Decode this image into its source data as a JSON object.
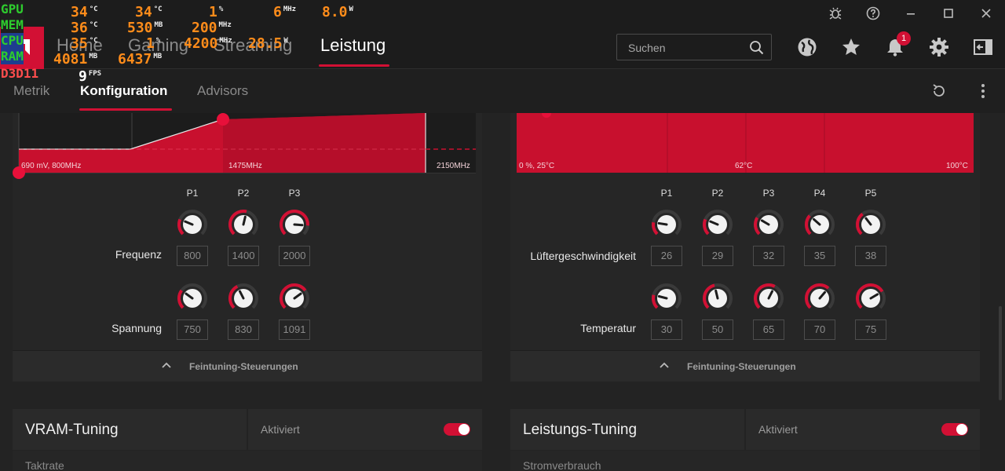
{
  "colors": {
    "accent": "#d21034",
    "osd_green": "#2ecc2e",
    "osd_orange": "#ff8c1a",
    "osd_red": "#ff4d4d"
  },
  "osd": {
    "rows": [
      {
        "label": "GPU",
        "values": [
          {
            "v": "34",
            "u": "°C"
          },
          {
            "v": "34",
            "u": "°C"
          },
          {
            "v": "1",
            "u": "%"
          },
          {
            "v": "6",
            "u": "MHz"
          },
          {
            "v": "8.0",
            "u": "W"
          }
        ]
      },
      {
        "label": "MEM",
        "values": [
          {
            "v": "36",
            "u": "°C"
          },
          {
            "v": "530",
            "u": "MB"
          },
          {
            "v": "200",
            "u": "MHz"
          }
        ]
      },
      {
        "label": "CPU",
        "values": [
          {
            "v": "35",
            "u": "°C"
          },
          {
            "v": "1",
            "u": "%"
          },
          {
            "v": "4200",
            "u": "MHz"
          },
          {
            "v": "28.5",
            "u": "W"
          }
        ]
      },
      {
        "label": "RAM",
        "values": [
          {
            "v": "4081",
            "u": "MB"
          },
          {
            "v": "6437",
            "u": "MB"
          }
        ]
      },
      {
        "label": "D3D11",
        "values": [
          {
            "v": "9",
            "u": "FPS"
          }
        ]
      }
    ]
  },
  "window": {
    "icons": [
      "bug-icon",
      "help-icon",
      "minimize-icon",
      "maximize-icon",
      "close-icon"
    ]
  },
  "nav": {
    "tabs": [
      {
        "label": "Home"
      },
      {
        "label": "Gaming"
      },
      {
        "label": "Streaming"
      },
      {
        "label": "Leistung"
      }
    ],
    "active": "Leistung",
    "search_placeholder": "Suchen",
    "notification_count": "1"
  },
  "subnav": {
    "tabs": [
      {
        "label": "Metrik"
      },
      {
        "label": "Konfiguration"
      },
      {
        "label": "Advisors"
      }
    ]
  },
  "gpu_tuning": {
    "chart": {
      "left_label": "690 mV, 800MHz",
      "mid_label": "1475MHz",
      "right_label": "2150MHz"
    },
    "states": [
      "P1",
      "P2",
      "P3"
    ],
    "rows": [
      {
        "label": "Frequenz",
        "values": [
          "800",
          "1400",
          "2000"
        ],
        "levels": [
          0.25,
          0.55,
          0.85
        ]
      },
      {
        "label": "Spannung",
        "values": [
          "750",
          "830",
          "1091"
        ],
        "levels": [
          0.3,
          0.4,
          0.7
        ]
      }
    ],
    "footer": "Feintuning-Steuerungen"
  },
  "fan_tuning": {
    "chart": {
      "left_label": "0 %, 25°C",
      "mid_label": "62°C",
      "right_label": "100°C"
    },
    "states": [
      "P1",
      "P2",
      "P3",
      "P4",
      "P5"
    ],
    "rows": [
      {
        "label": "Lüftergeschwindigkeit",
        "values": [
          "26",
          "29",
          "32",
          "35",
          "38"
        ],
        "levels": [
          0.2,
          0.25,
          0.28,
          0.32,
          0.36
        ]
      },
      {
        "label": "Temperatur",
        "values": [
          "30",
          "50",
          "65",
          "70",
          "75"
        ],
        "levels": [
          0.22,
          0.45,
          0.6,
          0.65,
          0.72
        ]
      }
    ],
    "footer": "Feintuning-Steuerungen"
  },
  "vram": {
    "title": "VRAM-Tuning",
    "status": "Aktiviert",
    "sub": "Taktrate"
  },
  "power": {
    "title": "Leistungs-Tuning",
    "status": "Aktiviert",
    "sub": "Stromverbrauch"
  }
}
